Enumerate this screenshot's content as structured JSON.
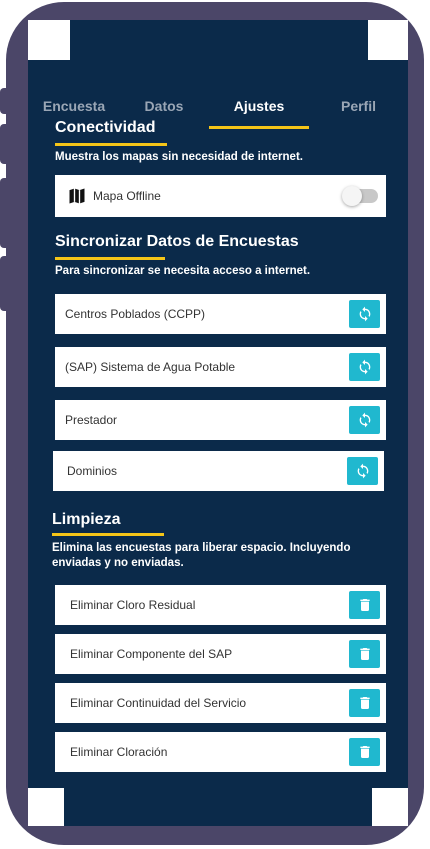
{
  "tabs": [
    {
      "label": "Encuesta"
    },
    {
      "label": "Datos"
    },
    {
      "label": "Ajustes"
    },
    {
      "label": "Perfil"
    }
  ],
  "active_tab": "Ajustes",
  "conectividad": {
    "title": "Conectividad",
    "description": "Muestra los mapas sin necesidad de internet.",
    "map_offline_label": "Mapa Offline",
    "map_offline_enabled": false
  },
  "sincronizar": {
    "title": "Sincronizar Datos de Encuestas",
    "description": "Para sincronizar se necesita acceso a internet.",
    "items": [
      {
        "label": "Centros Poblados (CCPP)"
      },
      {
        "label": "(SAP) Sistema de Agua Potable"
      },
      {
        "label": "Prestador"
      },
      {
        "label": "Dominios"
      }
    ]
  },
  "limpieza": {
    "title": "Limpieza",
    "description": "Elimina las encuestas para liberar espacio. Incluyendo enviadas y no enviadas.",
    "items": [
      {
        "label": "Eliminar Cloro Residual"
      },
      {
        "label": "Eliminar Componente del SAP"
      },
      {
        "label": "Eliminar Continuidad del Servicio"
      },
      {
        "label": "Eliminar Cloración"
      }
    ]
  },
  "colors": {
    "background": "#0b2a4a",
    "accent": "#f5c518",
    "action": "#20b8cf",
    "phone_frame": "#4b4668"
  },
  "icons": {
    "sync": "sync-icon",
    "delete": "trash-icon",
    "map": "map-icon"
  }
}
